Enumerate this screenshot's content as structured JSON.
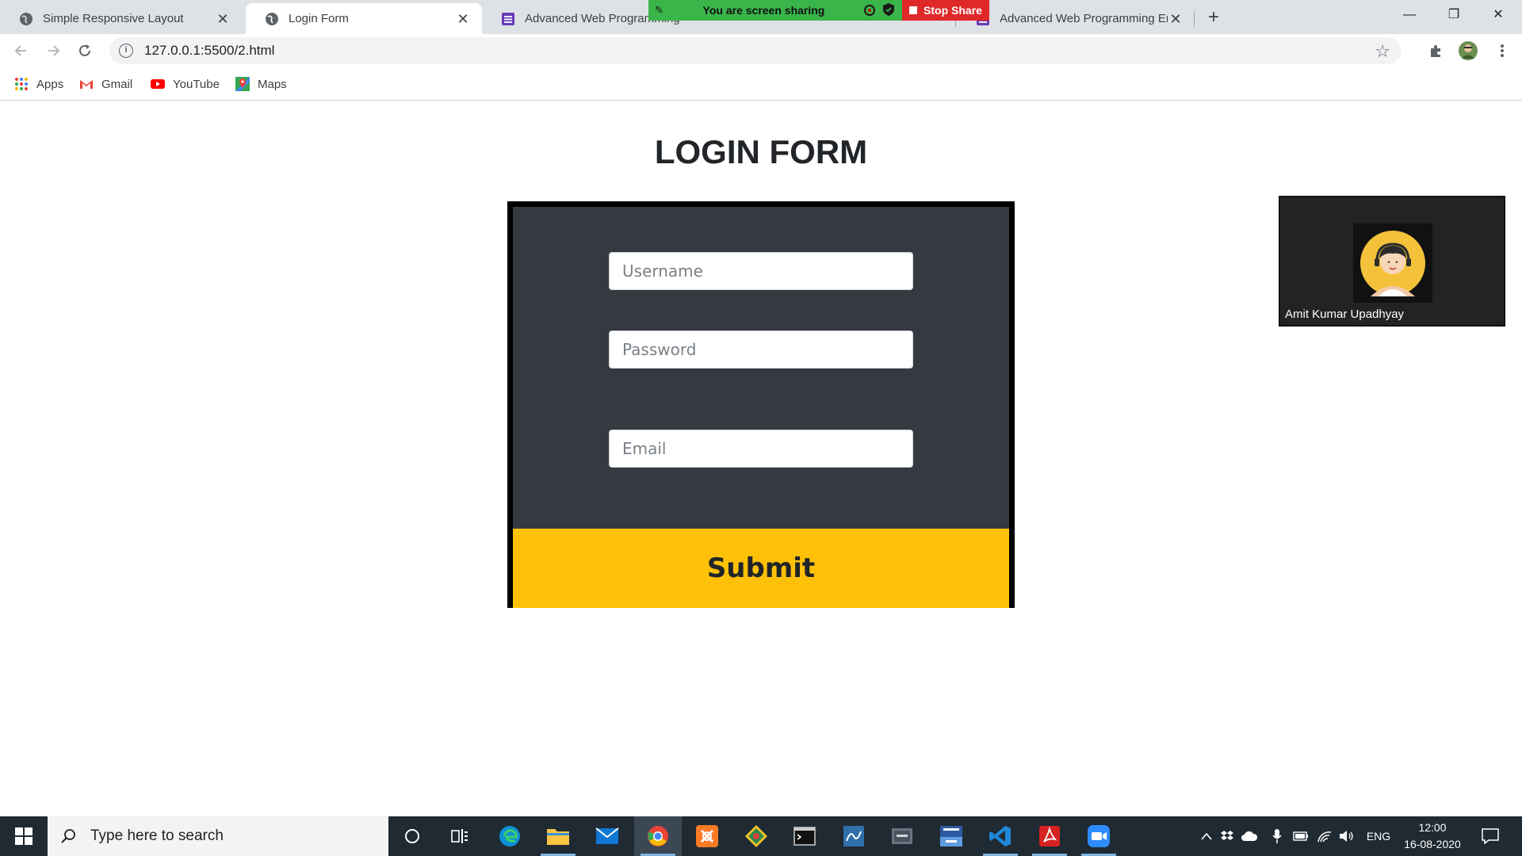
{
  "browser": {
    "tabs": [
      {
        "label": "Simple Responsive Layout"
      },
      {
        "label": "Login Form"
      },
      {
        "label": "Advanced Web Programming"
      },
      {
        "label": "Advanced Web Programming En"
      }
    ],
    "url": "127.0.0.1:5500/2.html",
    "bookmarks": [
      "Apps",
      "Gmail",
      "YouTube",
      "Maps"
    ]
  },
  "screen_share": {
    "status": "You are screen sharing",
    "stop_label": "Stop Share"
  },
  "page": {
    "title": "LOGIN FORM",
    "username_placeholder": "Username",
    "password_placeholder": "Password",
    "email_placeholder": "Email",
    "submit_label": "Submit"
  },
  "participant": {
    "name": "Amit Kumar Upadhyay"
  },
  "taskbar": {
    "search_placeholder": "Type here to search",
    "language": "ENG",
    "time": "12:00",
    "date": "16-08-2020"
  },
  "colors": {
    "form_bg": "#343a40",
    "submit_bg": "#ffc107",
    "share_green": "#39b54a",
    "stop_red": "#e02828"
  }
}
